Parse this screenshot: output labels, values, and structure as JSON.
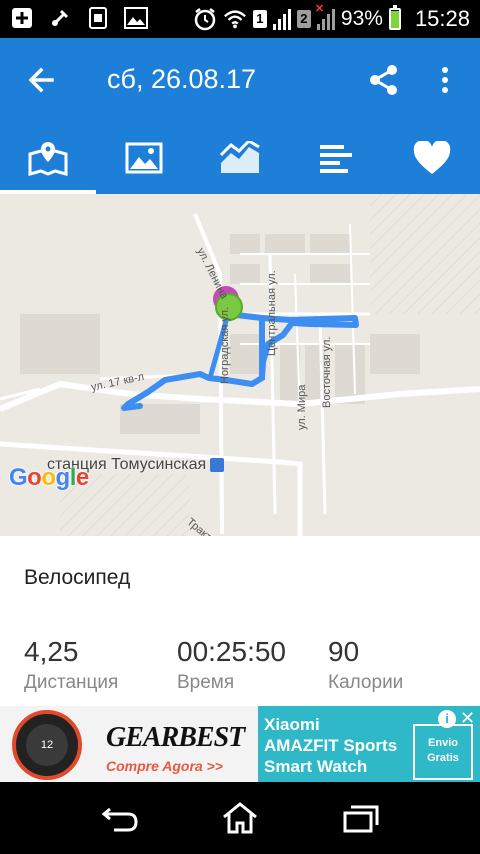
{
  "status_bar": {
    "sim1": "1",
    "sim2": "2",
    "battery_percent": "93%",
    "battery_level": 0.93,
    "time": "15:28"
  },
  "app_bar": {
    "title": "сб, 26.08.17"
  },
  "tabs": [
    {
      "icon": "map-icon",
      "selected": true
    },
    {
      "icon": "image-icon",
      "selected": false
    },
    {
      "icon": "chart-icon",
      "selected": false
    },
    {
      "icon": "bars-icon",
      "selected": false
    },
    {
      "icon": "heart-icon",
      "selected": false
    }
  ],
  "map": {
    "labels": {
      "lenina": "ул. Ленина",
      "centralnaya": "Центральная ул.",
      "nogradskaya": "Ноградская ул.",
      "vostochnaya": "Восточная ул.",
      "mira": "ул. Мира",
      "st17": "ул. 17 кв-л",
      "trakt": "Тракт"
    },
    "station": "станция Томусинская",
    "google_logo": "Google",
    "colors": {
      "route": "#3d8ef0",
      "start_marker": "#7ac943",
      "end_marker": "#c44ab5"
    }
  },
  "activity": {
    "type": "Велосипед",
    "stats": [
      {
        "value": "4,25",
        "label": "Дистанция"
      },
      {
        "value": "00:25:50",
        "label": "Время"
      },
      {
        "value": "90",
        "label": "Калории"
      }
    ]
  },
  "ad": {
    "brand": "GEARBEST",
    "tagline": "Compre Agora >>",
    "product_line1": "Xiaomi",
    "product_line2": "AMAZFIT Sports",
    "product_line3": "Smart Watch",
    "badge_line1": "Envio",
    "badge_line2": "Gratis"
  }
}
